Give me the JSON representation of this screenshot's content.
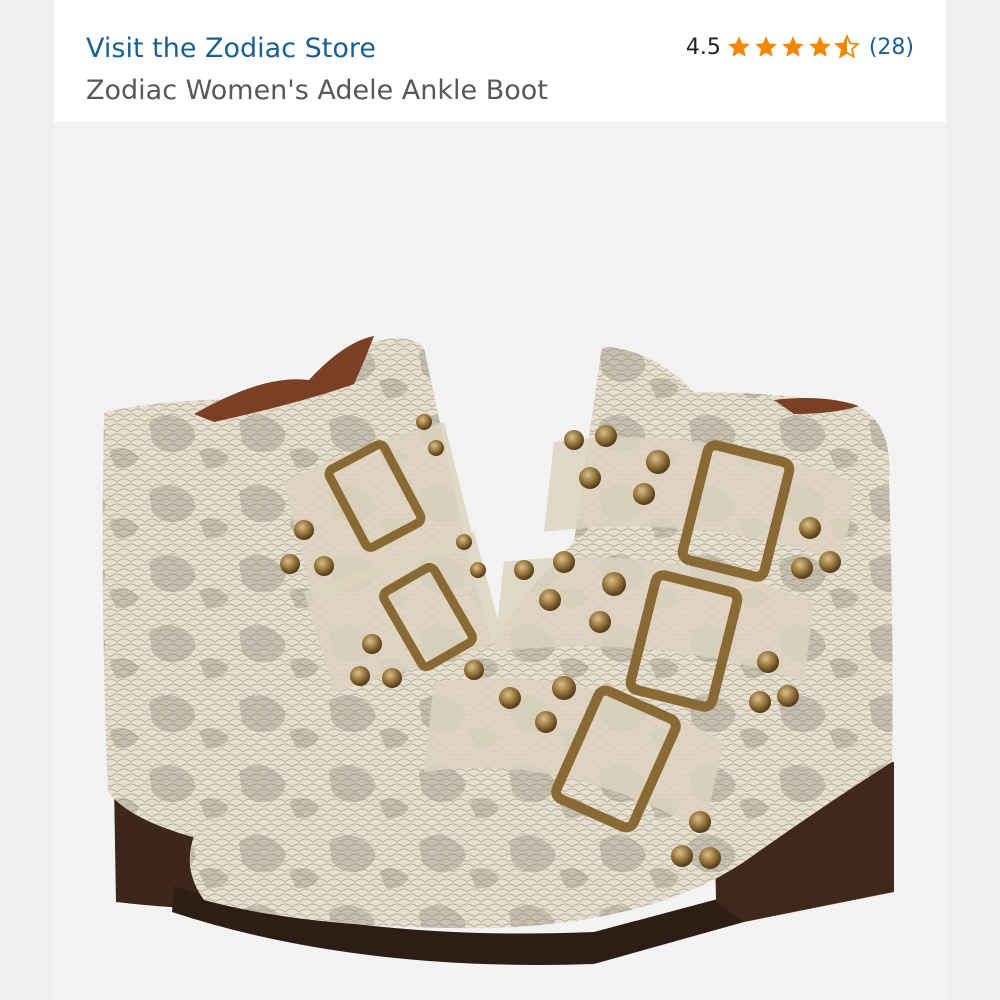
{
  "header": {
    "store_link_label": "Visit the Zodiac Store",
    "product_title": "Zodiac Women's Adele Ankle Boot"
  },
  "rating": {
    "value": "4.5",
    "stars_filled": 4.5,
    "stars_total": 5,
    "review_count": "(28)",
    "star_color": "#f08804"
  },
  "colors": {
    "link": "#1a6193",
    "title": "#565959",
    "background": "#f3f3f3",
    "boot_cream": "#e6ddcc",
    "snake_scale": "#8f8576",
    "brass": "#8a6a34",
    "sole": "#3a2418"
  },
  "image": {
    "subject": "snake-print ankle boots with three brass buckle straps"
  }
}
